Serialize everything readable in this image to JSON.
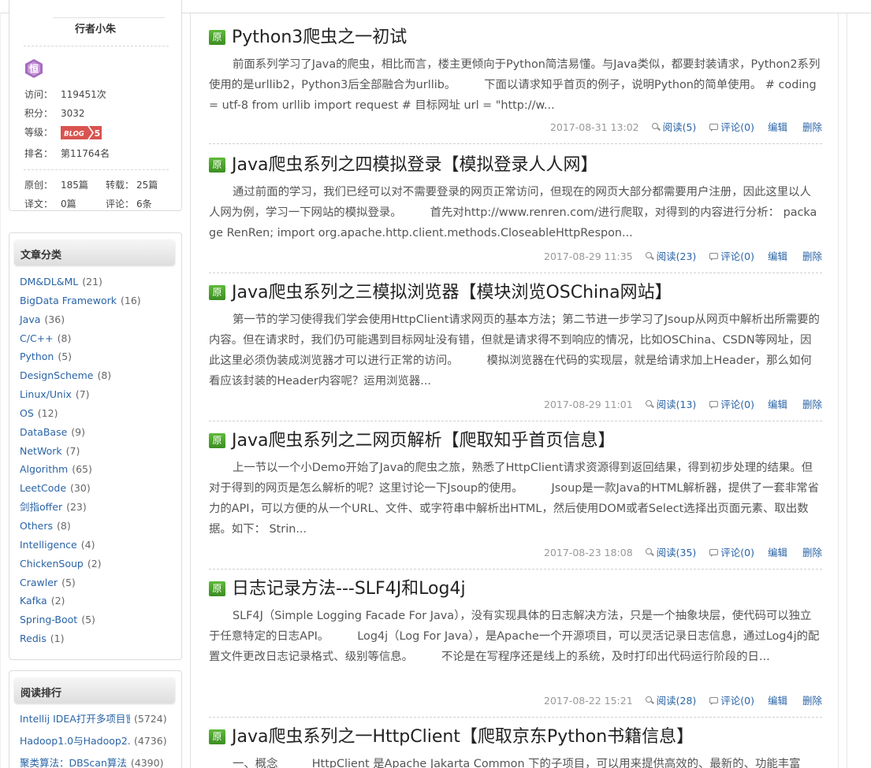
{
  "profile": {
    "name": "行者小朱",
    "stats": [
      {
        "key": "访问：",
        "value": "119451次"
      },
      {
        "key": "积分：",
        "value": "3032"
      },
      {
        "key": "等级：",
        "value": "BLOG 5"
      },
      {
        "key": "排名：",
        "value": "第11764名"
      }
    ],
    "counts": {
      "original_k": "原创：",
      "original_v": "185篇",
      "repost_k": "转载：",
      "repost_v": "25篇",
      "translate_k": "译文：",
      "translate_v": "0篇",
      "comment_k": "评论：",
      "comment_v": "6条"
    }
  },
  "categories": {
    "title": "文章分类",
    "items": [
      {
        "name": "DM&DL&ML",
        "count": "(21)"
      },
      {
        "name": "BigData Framework",
        "count": "(16)"
      },
      {
        "name": "Java",
        "count": "(36)"
      },
      {
        "name": "C/C++",
        "count": "(8)"
      },
      {
        "name": "Python",
        "count": "(5)"
      },
      {
        "name": "DesignScheme",
        "count": "(8)"
      },
      {
        "name": "Linux/Unix",
        "count": "(7)"
      },
      {
        "name": "OS",
        "count": "(12)"
      },
      {
        "name": "DataBase",
        "count": "(9)"
      },
      {
        "name": "NetWork",
        "count": "(7)"
      },
      {
        "name": "Algorithm",
        "count": "(65)"
      },
      {
        "name": "LeetCode",
        "count": "(30)"
      },
      {
        "name": "剑指offer",
        "count": "(23)"
      },
      {
        "name": "Others",
        "count": "(8)"
      },
      {
        "name": "Intelligence",
        "count": "(4)"
      },
      {
        "name": "ChickenSoup",
        "count": "(2)"
      },
      {
        "name": "Crawler",
        "count": "(5)"
      },
      {
        "name": "Kafka",
        "count": "(2)"
      },
      {
        "name": "Spring-Boot",
        "count": "(5)"
      },
      {
        "name": "Redis",
        "count": "(1)"
      }
    ]
  },
  "ranking": {
    "title": "阅读排行",
    "items": [
      {
        "name": "Intellij IDEA打开多项目窗",
        "count": "(5724)"
      },
      {
        "name": "Hadoop1.0与Hadoop2.0",
        "count": "(4736)"
      },
      {
        "name": "聚类算法：DBScan算法",
        "count": "(4390)"
      }
    ]
  },
  "articles": [
    {
      "badge": "原",
      "title": "Python3爬虫之一初试",
      "summary": "前面系列学习了Java的爬虫，相比而言，楼主更倾向于Python简洁易懂。与Java类似，都要封装请求，Python2系列使用的是urllib2，Python3后全部融合为urllib。　　　下面以请求知乎首页的例子，说明Python的简单使用。 # coding = utf-8 from urllib import request # 目标网址 url = \"http://w...",
      "date": "2017-08-31 13:02",
      "reads": "阅读(5)",
      "comments": "评论(0)",
      "edit": "编辑",
      "delete": "删除"
    },
    {
      "badge": "原",
      "title": "Java爬虫系列之四模拟登录【模拟登录人人网】",
      "summary": "通过前面的学习，我们已经可以对不需要登录的网页正常访问，但现在的网页大部分都需要用户注册，因此这里以人人网为例，学习一下网站的模拟登录。　　　首先对http://www.renren.com/进行爬取，对得到的内容进行分析： package RenRen; import org.apache.http.client.methods.CloseableHttpRespon...",
      "date": "2017-08-29 11:35",
      "reads": "阅读(23)",
      "comments": "评论(0)",
      "edit": "编辑",
      "delete": "删除"
    },
    {
      "badge": "原",
      "title": "Java爬虫系列之三模拟浏览器【模块浏览OSChina网站】",
      "summary": "第一节的学习使得我们学会使用HttpClient请求网页的基本方法；第二节进一步学习了Jsoup从网页中解析出所需要的内容。但在请求时，我们仍可能遇到目标网址没有错，但就是请求得不到响应的情况，比如OSChina、CSDN等网址，因此这里必须伪装成浏览器才可以进行正常的访问。　　　模拟浏览器在代码的实现层，就是给请求加上Header，那么如何看应该封装的Header内容呢？运用浏览器...",
      "date": "2017-08-29 11:01",
      "reads": "阅读(13)",
      "comments": "评论(0)",
      "edit": "编辑",
      "delete": "删除"
    },
    {
      "badge": "原",
      "title": "Java爬虫系列之二网页解析【爬取知乎首页信息】",
      "summary": "上一节以一个小Demo开始了Java的爬虫之旅，熟悉了HttpClient请求资源得到返回结果，得到初步处理的结果。但对于得到的网页是怎么解析的呢？这里讨论一下Jsoup的使用。　　　Jsoup是一款Java的HTML解析器，提供了一套非常省力的API，可以方便的从一个URL、文件、或字符串中解析出HTML，然后使用DOM或者Select选择出页面元素、取出数据。如下： Strin...",
      "date": "2017-08-23 18:08",
      "reads": "阅读(35)",
      "comments": "评论(0)",
      "edit": "编辑",
      "delete": "删除"
    },
    {
      "badge": "原",
      "title": "日志记录方法---SLF4J和Log4j",
      "summary": "SLF4J（Simple Logging Facade For Java），没有实现具体的日志解决方法，只是一个抽象块层，使代码可以独立于任意特定的日志API。　　　Log4j（Log For Java），是Apache一个开源项目，可以灵活记录日志信息，通过Log4j的配置文件更改日志记录格式、级别等信息。　　　不论是在写程序还是线上的系统，及时打印出代码运行阶段的日...",
      "date": "2017-08-22 15:21",
      "reads": "阅读(28)",
      "comments": "评论(0)",
      "edit": "编辑",
      "delete": "删除"
    },
    {
      "badge": "原",
      "title": "Java爬虫系列之一HttpClient【爬取京东Python书籍信息】",
      "summary": "一、概念　　　HttpClient 是Apache Jakarta Common 下的子项目，可以用来提供高效的、最新的、功能丰富",
      "date": "",
      "reads": "",
      "comments": "",
      "edit": "",
      "delete": ""
    }
  ],
  "colors": {
    "link": "#2a64a6",
    "badge_green": "#3c8e22",
    "level_red": "#d9534f",
    "medal_purple": "#9b59b6"
  }
}
